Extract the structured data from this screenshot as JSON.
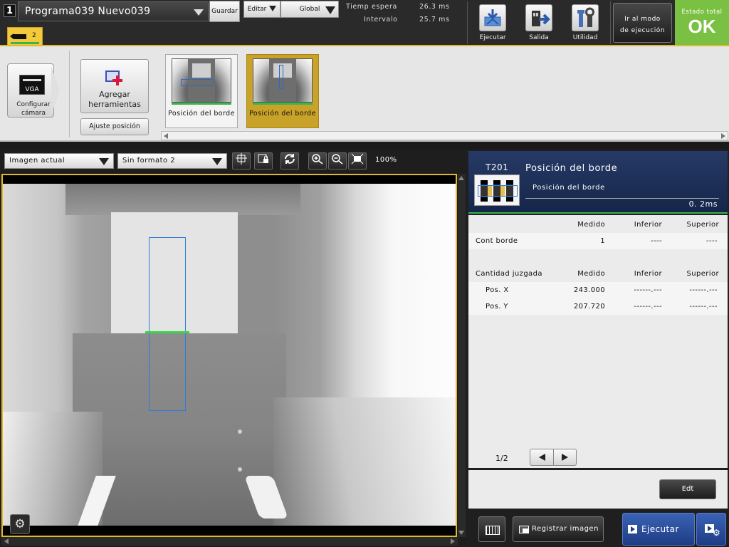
{
  "header": {
    "program_number": "1",
    "program_name": "Programa039  Nuevo039",
    "save_label": "Guardar",
    "edit_label": "Editar",
    "scope_label": "Global",
    "wait_time_label": "Tiemp espera",
    "wait_time_value": "26.3  ms",
    "interval_label": "Intervalo",
    "interval_value": "25.7  ms",
    "run_label": "Ejecutar",
    "output_label": "Salida",
    "utility_label": "Utilidad",
    "go_run_mode_line1": "Ir al modo",
    "go_run_mode_line2": "de ejecución",
    "total_status_label": "Estado total",
    "total_status_value": "OK",
    "camera_tab_number": "2"
  },
  "tools_strip": {
    "camera_resolution": "VGA",
    "configure_camera_line1": "Configurar",
    "configure_camera_line2": "cámara",
    "add_tools_line1": "Agregar",
    "add_tools_line2": "herramientas",
    "position_adjust_label": "Ajuste posición",
    "tools": [
      {
        "label": "Posición del borde",
        "selected": false
      },
      {
        "label": "Posición del borde",
        "selected": true
      }
    ]
  },
  "image_toolbar": {
    "image_source": "Imagen actual",
    "format": "Sin formato 2",
    "zoom_level": "100%"
  },
  "result_panel": {
    "tool_id": "T201",
    "tool_type": "Posición del borde",
    "tool_name": "Posición del borde",
    "processing_time": "0. 2ms",
    "table1_headers": {
      "name": "",
      "measured": "Medido",
      "lower": "Inferior",
      "upper": "Superior"
    },
    "table1_rows": [
      {
        "name": "Cont borde",
        "measured": "1",
        "lower": "----",
        "upper": "----"
      }
    ],
    "table2_headers": {
      "name": "Cantidad juzgada",
      "measured": "Medido",
      "lower": "Inferior",
      "upper": "Superior"
    },
    "table2_rows": [
      {
        "name": "Pos.  X",
        "measured": "243.000",
        "lower": "------.---",
        "upper": "------.---"
      },
      {
        "name": "Pos.  Y",
        "measured": "207.720",
        "lower": "------.---",
        "upper": "------.---"
      }
    ],
    "page_indicator": "1/2",
    "edit_label": "Edt",
    "register_image_label": "Registrar imagen",
    "run_label": "Ejecutar"
  },
  "colors": {
    "accent_gold": "#e3b92b",
    "status_ok_green": "#7ac143",
    "edge_line_green": "#39d64a",
    "roi_blue": "#2e7be0",
    "panel_header_blue": "#263a66"
  }
}
